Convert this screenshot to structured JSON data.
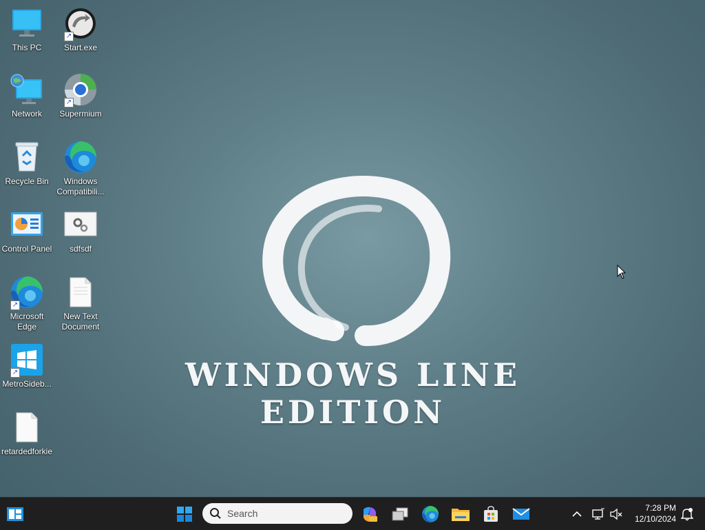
{
  "desktop": {
    "icons": [
      {
        "label": "This PC",
        "icon": "monitor-icon"
      },
      {
        "label": "Start.exe",
        "icon": "start-exe-icon"
      },
      {
        "label": "Network",
        "icon": "network-icon"
      },
      {
        "label": "Supermium",
        "icon": "supermium-icon"
      },
      {
        "label": "Recycle Bin",
        "icon": "recycle-bin-icon"
      },
      {
        "label": "Windows Compatibili...",
        "icon": "edge-icon"
      },
      {
        "label": "Control Panel",
        "icon": "control-panel-icon"
      },
      {
        "label": "sdfsdf",
        "icon": "settings-file-icon"
      },
      {
        "label": "Microsoft Edge",
        "icon": "edge-icon"
      },
      {
        "label": "New Text Document",
        "icon": "text-document-icon"
      },
      {
        "label": "MetroSideb...",
        "icon": "metro-sidebar-icon"
      },
      {
        "label": "retardedforkie",
        "icon": "text-document-icon"
      }
    ]
  },
  "wallpaper": {
    "caption": "WINDOWS LINE EDITION"
  },
  "taskbar": {
    "search_placeholder": "Search",
    "apps": [
      "widgets-icon",
      "start-icon",
      "copilot-icon",
      "task-view-icon",
      "edge-icon",
      "file-explorer-icon",
      "store-icon",
      "mail-icon"
    ],
    "time": "7:28 PM",
    "date": "12/10/2024"
  },
  "colors": {
    "accent": "#0078d4",
    "taskbar": "#1f1f1f",
    "wallpaper": "#5f7f89"
  }
}
